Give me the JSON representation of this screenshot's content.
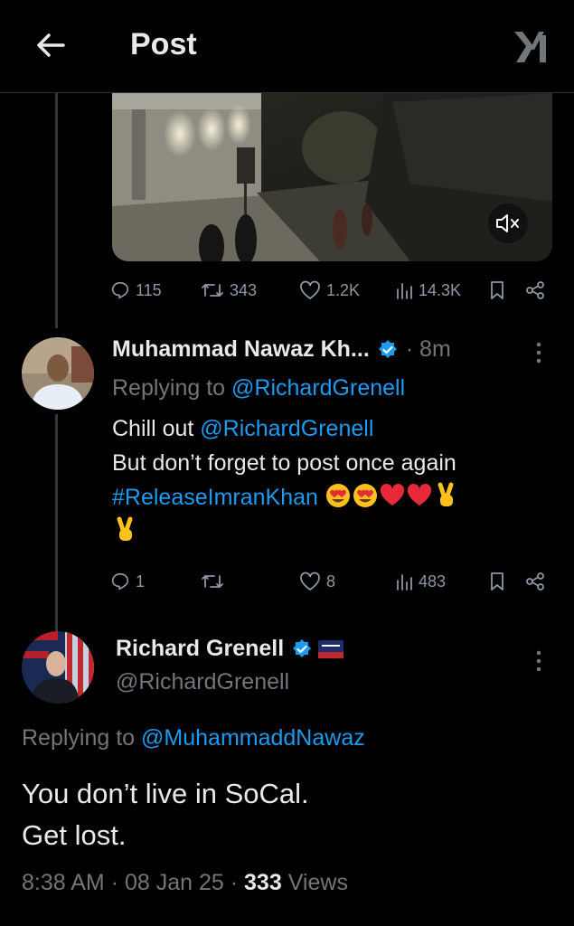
{
  "header": {
    "title": "Post",
    "back_icon": "back-arrow-icon",
    "logo_icon": "x-logo-icon"
  },
  "video_stats": {
    "replies": "115",
    "reposts": "343",
    "likes": "1.2K",
    "views": "14.3K"
  },
  "reply_tweet": {
    "author": "Muhammad Nawaz Kh...",
    "time": "· 8m",
    "replying_prefix": "Replying to",
    "replying_handle": "@RichardGrenell",
    "line1_text": "Chill out ",
    "line1_mention": "@RichardGrenell",
    "line2": "But don’t forget to post once again",
    "hashtag": "#ReleaseImranKhan",
    "emojis": [
      "heart-eyes",
      "heart-eyes",
      "red-heart",
      "red-heart",
      "victory-hand",
      "victory-hand"
    ],
    "stats": {
      "replies": "1",
      "reposts": "",
      "likes": "8",
      "views": "483"
    }
  },
  "main_tweet": {
    "author": "Richard Grenell",
    "handle": "@RichardGrenell",
    "replying_prefix": "Replying to",
    "replying_handle": "@MuhammaddNawaz",
    "line1": "You don’t live in SoCal.",
    "line2": "Get lost.",
    "time": "8:38 AM",
    "date": "08 Jan 25",
    "views_count": "333",
    "views_label": "Views"
  },
  "colors": {
    "accent": "#1d9bf0",
    "muted": "#71767b",
    "text": "#e7e9ea",
    "like_red": "#f91880"
  }
}
